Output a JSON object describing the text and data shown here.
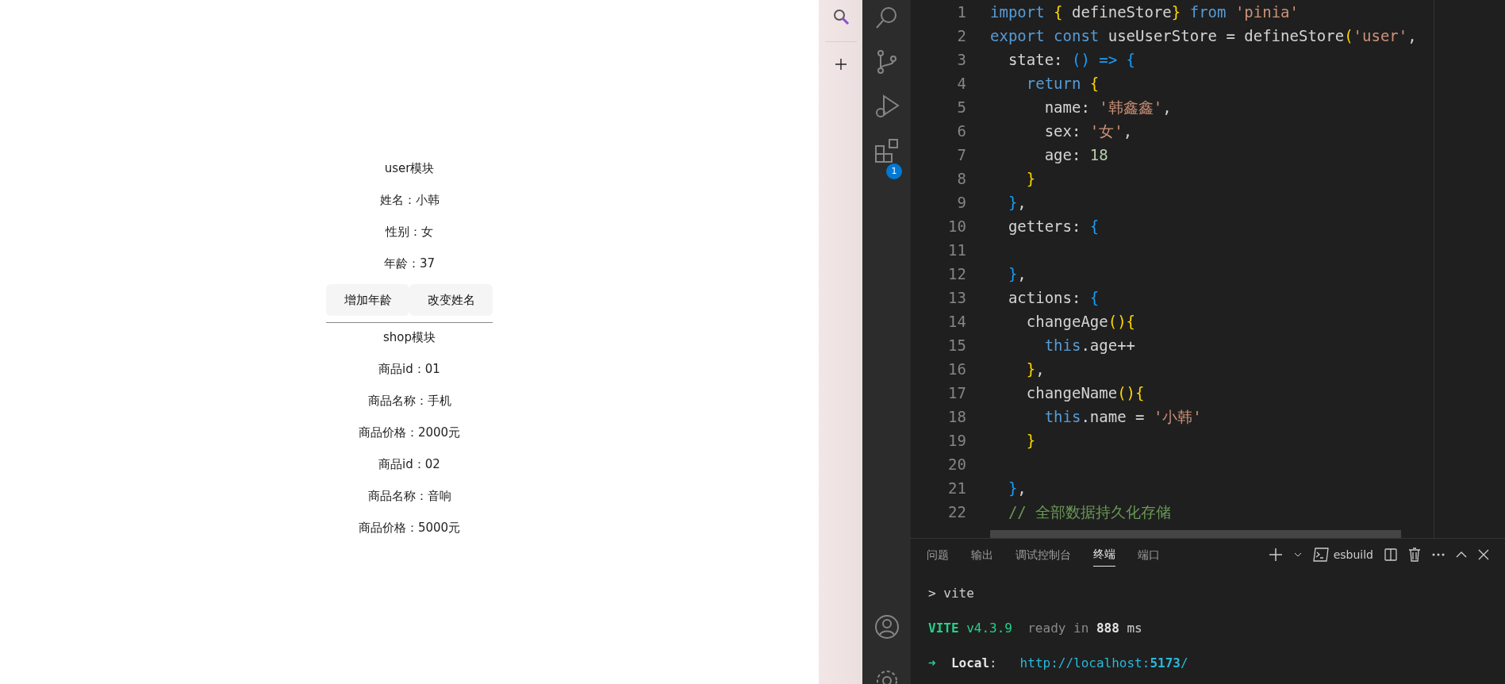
{
  "browser_page": {
    "user_title": "user模块",
    "user_fields": [
      "姓名：小韩",
      "性别：女",
      "年龄：37"
    ],
    "buttons": [
      "增加年龄",
      "改变姓名"
    ],
    "shop_title": "shop模块",
    "shop_fields": [
      "商品id：01",
      "商品名称：手机",
      "商品价格：2000元",
      "商品id：02",
      "商品名称：音响",
      "商品价格：5000元"
    ]
  },
  "activity_bar": {
    "extensions_badge": "1"
  },
  "editor": {
    "lines": [
      {
        "number": "1",
        "tokens": [
          {
            "kind": "keyword",
            "text": "import"
          },
          {
            "kind": "brace",
            "text": " {"
          },
          {
            "kind": "plain",
            "text": " defineStore"
          },
          {
            "kind": "brace",
            "text": "}"
          },
          {
            "kind": "keyword",
            "text": " from"
          },
          {
            "kind": "string",
            "text": " 'pinia'"
          }
        ]
      },
      {
        "number": "2",
        "tokens": [
          {
            "kind": "keyword",
            "text": "export const"
          },
          {
            "kind": "plain",
            "text": " useUserStore = defineStore"
          },
          {
            "kind": "brace",
            "text": "("
          },
          {
            "kind": "string",
            "text": "'user'"
          },
          {
            "kind": "plain",
            "text": ","
          }
        ]
      },
      {
        "number": "3",
        "tokens": [
          {
            "kind": "plain",
            "text": "  state: "
          },
          {
            "kind": "bracket",
            "text": "() => {"
          }
        ]
      },
      {
        "number": "4",
        "tokens": [
          {
            "kind": "keyword",
            "text": "    return"
          },
          {
            "kind": "brace",
            "text": " {"
          }
        ]
      },
      {
        "number": "5",
        "tokens": [
          {
            "kind": "plain",
            "text": "      name: "
          },
          {
            "kind": "string",
            "text": "'韩鑫鑫'"
          },
          {
            "kind": "plain",
            "text": ","
          }
        ]
      },
      {
        "number": "6",
        "tokens": [
          {
            "kind": "plain",
            "text": "      sex: "
          },
          {
            "kind": "string",
            "text": "'女'"
          },
          {
            "kind": "plain",
            "text": ","
          }
        ]
      },
      {
        "number": "7",
        "tokens": [
          {
            "kind": "plain",
            "text": "      age: "
          },
          {
            "kind": "number",
            "text": "18"
          }
        ]
      },
      {
        "number": "8",
        "tokens": [
          {
            "kind": "brace",
            "text": "    }"
          }
        ]
      },
      {
        "number": "9",
        "tokens": [
          {
            "kind": "bracket",
            "text": "  }"
          },
          {
            "kind": "plain",
            "text": ","
          }
        ]
      },
      {
        "number": "10",
        "tokens": [
          {
            "kind": "plain",
            "text": "  getters: "
          },
          {
            "kind": "bracket",
            "text": "{"
          }
        ]
      },
      {
        "number": "11"
      },
      {
        "number": "12",
        "tokens": [
          {
            "kind": "bracket",
            "text": "  }"
          },
          {
            "kind": "plain",
            "text": ","
          }
        ]
      },
      {
        "number": "13",
        "tokens": [
          {
            "kind": "plain",
            "text": "  actions: "
          },
          {
            "kind": "bracket",
            "text": "{"
          }
        ]
      },
      {
        "number": "14",
        "tokens": [
          {
            "kind": "plain",
            "text": "    changeAge"
          },
          {
            "kind": "brace",
            "text": "(){"
          }
        ]
      },
      {
        "number": "15",
        "tokens": [
          {
            "kind": "keyword",
            "text": "      this"
          },
          {
            "kind": "plain",
            "text": ".age++"
          }
        ]
      },
      {
        "number": "16",
        "tokens": [
          {
            "kind": "brace",
            "text": "    }"
          },
          {
            "kind": "plain",
            "text": ","
          }
        ]
      },
      {
        "number": "17",
        "tokens": [
          {
            "kind": "plain",
            "text": "    changeName"
          },
          {
            "kind": "brace",
            "text": "(){"
          }
        ]
      },
      {
        "number": "18",
        "tokens": [
          {
            "kind": "keyword",
            "text": "      this"
          },
          {
            "kind": "plain",
            "text": ".name = "
          },
          {
            "kind": "string",
            "text": "'小韩'"
          }
        ]
      },
      {
        "number": "19",
        "tokens": [
          {
            "kind": "brace",
            "text": "    }"
          }
        ]
      },
      {
        "number": "20"
      },
      {
        "number": "21",
        "tokens": [
          {
            "kind": "bracket",
            "text": "  }"
          },
          {
            "kind": "plain",
            "text": ","
          }
        ]
      },
      {
        "number": "22",
        "tokens": [
          {
            "kind": "comment",
            "text": "  // 全部数据持久化存储"
          }
        ]
      }
    ]
  },
  "panel": {
    "tabs": [
      {
        "label": "问题",
        "selected": false
      },
      {
        "label": "输出",
        "selected": false
      },
      {
        "label": "调试控制台",
        "selected": false
      },
      {
        "label": "终端",
        "selected": true
      },
      {
        "label": "端口",
        "selected": false
      }
    ],
    "terminal_name": "esbuild",
    "terminal_lines": [
      [
        {
          "kind": "plain",
          "text": "> vite"
        }
      ],
      [
        {
          "kind": "vite",
          "text": "VITE"
        },
        {
          "kind": "green",
          "text": " v4.3.9"
        },
        {
          "kind": "dim",
          "text": "  ready in "
        },
        {
          "kind": "bold",
          "text": "888"
        },
        {
          "kind": "plain",
          "text": " ms"
        }
      ],
      [
        {
          "kind": "green",
          "text": "➜"
        },
        {
          "kind": "bold",
          "text": "  Local"
        },
        {
          "kind": "plain",
          "text": ":   "
        },
        {
          "kind": "link",
          "text": "http://localhost:"
        },
        {
          "kind": "linkbold",
          "text": "5173"
        },
        {
          "kind": "link",
          "text": "/"
        }
      ]
    ]
  }
}
